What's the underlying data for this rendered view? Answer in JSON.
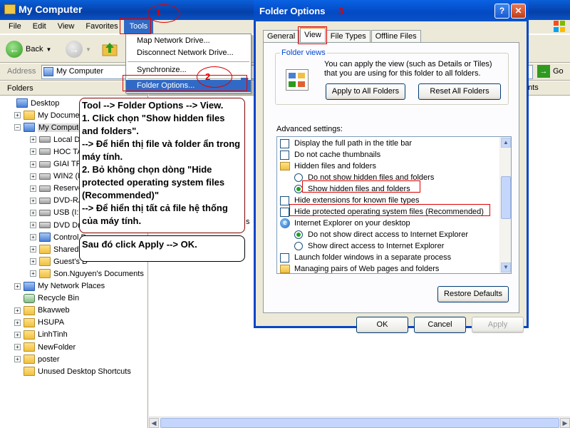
{
  "explorer": {
    "title": "My Computer",
    "menu": [
      "File",
      "Edit",
      "View",
      "Favorites",
      "Tools"
    ],
    "toolbar": {
      "back_label": "Back"
    },
    "address": {
      "label": "Address",
      "value": "My Computer",
      "go_label": "Go"
    },
    "folders_label": "Folders",
    "folders_close": "×",
    "right_column_label": "ents",
    "tree": [
      {
        "label": "Desktop",
        "icon": "desktop-icon",
        "expander": "",
        "indent": 0
      },
      {
        "label": "My Documen",
        "icon": "folder-icon",
        "expander": "+",
        "indent": 1
      },
      {
        "label": "My Computer",
        "icon": "computer-icon",
        "expander": "−",
        "indent": 1,
        "selected": true
      },
      {
        "label": "Local Disk",
        "icon": "drive-icon",
        "expander": "+",
        "indent": 2
      },
      {
        "label": "HOC TAP",
        "icon": "drive-icon",
        "expander": "+",
        "indent": 2
      },
      {
        "label": "GIAI TRI",
        "icon": "drive-icon",
        "expander": "+",
        "indent": 2
      },
      {
        "label": "WIN2 (F:",
        "icon": "drive-icon",
        "expander": "+",
        "indent": 2
      },
      {
        "label": "Reserve",
        "icon": "drive-icon",
        "expander": "+",
        "indent": 2
      },
      {
        "label": "DVD-RAM",
        "icon": "dvd-icon",
        "expander": "+",
        "indent": 2
      },
      {
        "label": "USB (I:)",
        "icon": "usb-icon",
        "expander": "+",
        "indent": 2
      },
      {
        "label": "DVD Driv",
        "icon": "dvd-icon",
        "expander": "+",
        "indent": 2
      },
      {
        "label": "Control P",
        "icon": "control-panel-icon",
        "expander": "+",
        "indent": 2
      },
      {
        "label": "Shared D",
        "icon": "folder-icon",
        "expander": "+",
        "indent": 2
      },
      {
        "label": "Guest's D",
        "icon": "folder-icon",
        "expander": "+",
        "indent": 2
      },
      {
        "label": "Son.Nguyen's Documents",
        "icon": "folder-icon",
        "expander": "+",
        "indent": 2
      },
      {
        "label": "My Network Places",
        "icon": "network-icon",
        "expander": "+",
        "indent": 1
      },
      {
        "label": "Recycle Bin",
        "icon": "recycle-bin-icon",
        "expander": "",
        "indent": 1
      },
      {
        "label": "Bkavweb",
        "icon": "folder-icon",
        "expander": "+",
        "indent": 1
      },
      {
        "label": "HSUPA",
        "icon": "folder-icon",
        "expander": "+",
        "indent": 1
      },
      {
        "label": "LinhTinh",
        "icon": "folder-icon",
        "expander": "+",
        "indent": 1
      },
      {
        "label": "NewFolder",
        "icon": "folder-icon",
        "expander": "+",
        "indent": 1
      },
      {
        "label": "poster",
        "icon": "folder-icon",
        "expander": "+",
        "indent": 1
      },
      {
        "label": "Unused Desktop Shortcuts",
        "icon": "folder-icon",
        "expander": "",
        "indent": 1
      }
    ]
  },
  "tools_menu": {
    "items": [
      "Map Network Drive...",
      "Disconnect Network Drive...",
      "Synchronize...",
      "Folder Options..."
    ],
    "highlighted": "Folder Options..."
  },
  "dialog": {
    "title": "Folder Options",
    "tabs": [
      "General",
      "View",
      "File Types",
      "Offline Files"
    ],
    "active_tab": "View",
    "folder_views": {
      "label": "Folder views",
      "text": "You can apply the view (such as Details or Tiles) that you are using for this folder to all folders.",
      "apply_all": "Apply to All Folders",
      "reset_all": "Reset All Folders"
    },
    "advanced_label": "Advanced settings:",
    "advanced": [
      {
        "type": "checkbox",
        "label": "Display the full path in the title bar",
        "checked": false,
        "indent": 0
      },
      {
        "type": "checkbox",
        "label": "Do not cache thumbnails",
        "checked": false,
        "indent": 0
      },
      {
        "type": "folder",
        "label": "Hidden files and folders",
        "indent": 0
      },
      {
        "type": "radio",
        "label": "Do not show hidden files and folders",
        "checked": false,
        "indent": 1
      },
      {
        "type": "radio",
        "label": "Show hidden files and folders",
        "checked": true,
        "indent": 1
      },
      {
        "type": "checkbox",
        "label": "Hide extensions for known file types",
        "checked": false,
        "indent": 0
      },
      {
        "type": "checkbox",
        "label": "Hide protected operating system files (Recommended)",
        "checked": false,
        "indent": 0
      },
      {
        "type": "ie",
        "label": "Internet Explorer on your desktop",
        "indent": 0
      },
      {
        "type": "radio",
        "label": "Do not show direct access to Internet Explorer",
        "checked": true,
        "indent": 1
      },
      {
        "type": "radio",
        "label": "Show direct access to Internet Explorer",
        "checked": false,
        "indent": 1
      },
      {
        "type": "checkbox",
        "label": "Launch folder windows in a separate process",
        "checked": false,
        "indent": 0
      },
      {
        "type": "folder",
        "label": "Managing pairs of Web pages and folders",
        "indent": 0
      }
    ],
    "restore_defaults": "Restore Defaults",
    "ok": "OK",
    "cancel": "Cancel",
    "apply": "Apply"
  },
  "annotations": {
    "step1": "1",
    "step2": "2",
    "step3": "3",
    "note_main": "Tool --> Folder Options --> View.\n1. Click chọn \"Show hidden files and folders\".\n--> Để hiển thị file và folder ẩn trong máy tính.\n2. Bỏ không chọn dòng \"Hide protected operating system files (Recommended)\"\n--> Để hiển thị tất cả file hệ thống của máy tính.",
    "note_apply": "Sau đó click Apply --> OK.",
    "stray_char": "s"
  },
  "colors": {
    "accent": "#316ac5",
    "annotation_red": "#e00000",
    "titlebar": "#0a5fd8"
  }
}
